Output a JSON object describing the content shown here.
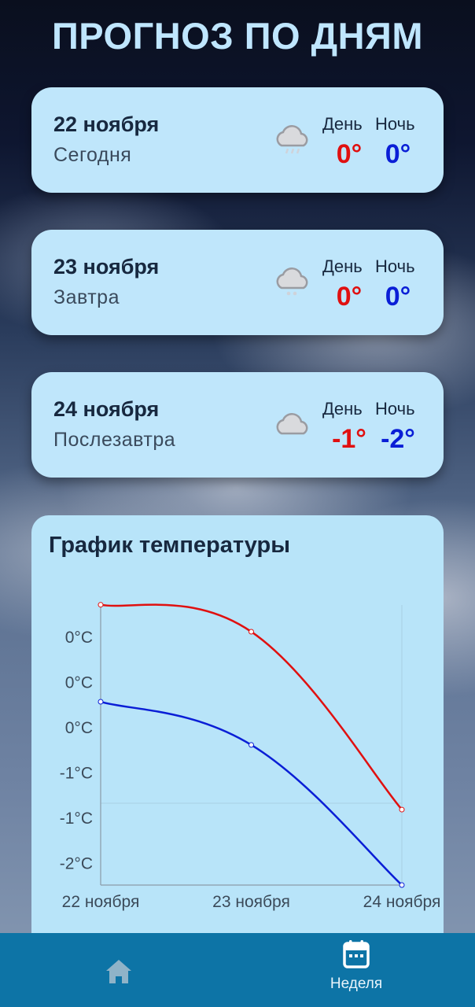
{
  "header": {
    "title": "ПРОГНОЗ ПО ДНЯМ"
  },
  "days": [
    {
      "date": "22 ноября",
      "relative": "Сегодня",
      "icon": "cloud-rain-icon",
      "day_label": "День",
      "night_label": "Ночь",
      "day_temp": "0°",
      "night_temp": "0°"
    },
    {
      "date": "23 ноября",
      "relative": "Завтра",
      "icon": "cloud-snow-icon",
      "day_label": "День",
      "night_label": "Ночь",
      "day_temp": "0°",
      "night_temp": "0°"
    },
    {
      "date": "24 ноября",
      "relative": "Послезавтра",
      "icon": "cloud-icon",
      "day_label": "День",
      "night_label": "Ночь",
      "day_temp": "-1°",
      "night_temp": "-2°"
    }
  ],
  "chart_section": {
    "title": "График температуры"
  },
  "chart_data": {
    "type": "line",
    "categories": [
      "22 ноября",
      "23 ноября",
      "24 ноября"
    ],
    "y_tick_labels": [
      "0°C",
      "0°C",
      "0°C",
      "-1°C",
      "-1°C",
      "-2°C"
    ],
    "ylim": [
      -2.2,
      0.5
    ],
    "grid": true,
    "series": [
      {
        "key": "day",
        "color": "#e01010",
        "values": [
          0.4,
          0.15,
          -1.5
        ]
      },
      {
        "key": "night",
        "color": "#0a1ed6",
        "values": [
          -0.5,
          -0.9,
          -2.2
        ]
      }
    ]
  },
  "bottom_nav": {
    "home_icon": "home-icon",
    "week_icon": "calendar-icon",
    "week_label": "Неделя",
    "active_color": "#ffffff",
    "inactive_color": "#8fb3c8"
  }
}
